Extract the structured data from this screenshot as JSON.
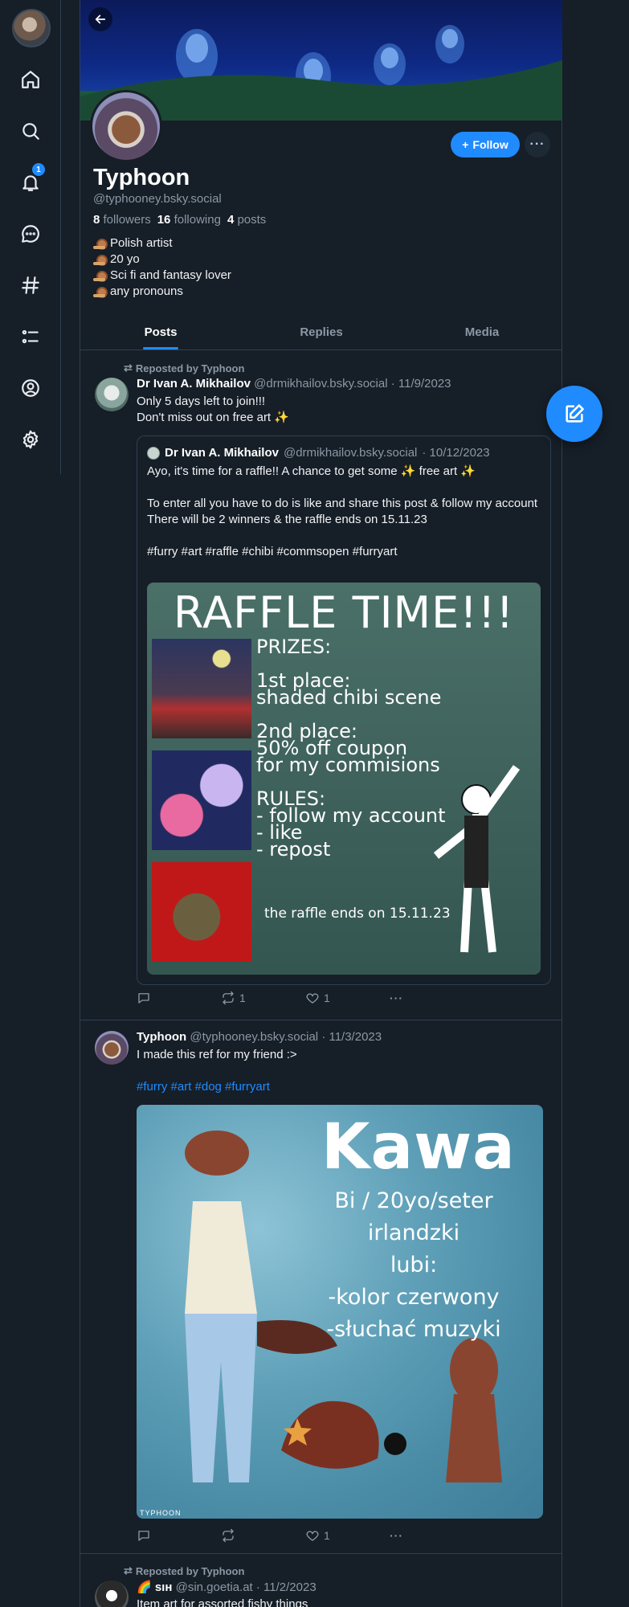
{
  "profile": {
    "display_name": "Typhoon",
    "handle": "@typhooney.bsky.social",
    "followers_count": "8",
    "followers_label": "followers",
    "following_count": "16",
    "following_label": "following",
    "posts_count": "4",
    "posts_label": "posts",
    "follow_label": "Follow",
    "bio": [
      "Polish artist",
      "20 yo",
      "Sci fi and fantasy lover",
      "any pronouns"
    ]
  },
  "nav": {
    "notifications_badge": "1",
    "icons": [
      "home-icon",
      "search-icon",
      "bell-icon",
      "chat-icon",
      "hash-icon",
      "list-icon",
      "profile-icon",
      "gear-icon"
    ]
  },
  "tabs": [
    "Posts",
    "Replies",
    "Media"
  ],
  "posts": [
    {
      "repost_label": "Reposted by Typhoon",
      "author": "Dr Ivan A. Mikhailov",
      "handle": "@drmikhailov.bsky.social",
      "date": "· 11/9/2023",
      "text_line1": "Only 5 days left to join!!!",
      "text_line2": "Don't miss out on free art ✨",
      "quote": {
        "author": "Dr Ivan A. Mikhailov",
        "handle": "@drmikhailov.bsky.social",
        "date": "· 10/12/2023",
        "text": "Ayo, it's time for a raffle!! A chance to get some ✨ free art ✨\n\nTo enter all you have to do is like and share this post & follow my account\nThere will be 2 winners & the raffle ends on 15.11.23\n\n#furry #art #raffle #chibi #commsopen #furryart",
        "image": {
          "title": "RAFFLE TIME!!!",
          "body": "PRIZES:\n\n1st place:\nshaded chibi scene\n\n2nd place:\n50% off coupon\nfor my commisions\n\nRULES:\n- follow my account\n- like\n- repost",
          "footer": "the raffle ends on 15.11.23"
        }
      },
      "reposts": "1",
      "likes": "1"
    },
    {
      "author": "Typhoon",
      "handle": "@typhooney.bsky.social",
      "date": "· 11/3/2023",
      "text": "I made this ref for my friend :>",
      "hashtags": "#furry #art #dog #furryart",
      "image": {
        "title": "Kawa",
        "text": "Bi / 20yo/seter irlandzki\nlubi:\n-kolor czerwony\n-słuchać muzyki",
        "signature": "TYPHOON"
      },
      "likes": "1"
    },
    {
      "repost_label": "Reposted by Typhoon",
      "author": "🌈 sıн",
      "handle": "@sin.goetia.at",
      "date": "· 11/2/2023",
      "text": "Item art for assorted fishy things"
    }
  ],
  "colors": {
    "accent": "#208bfe",
    "background": "#161e27",
    "border": "#2e4052",
    "muted": "#8b98a5"
  }
}
